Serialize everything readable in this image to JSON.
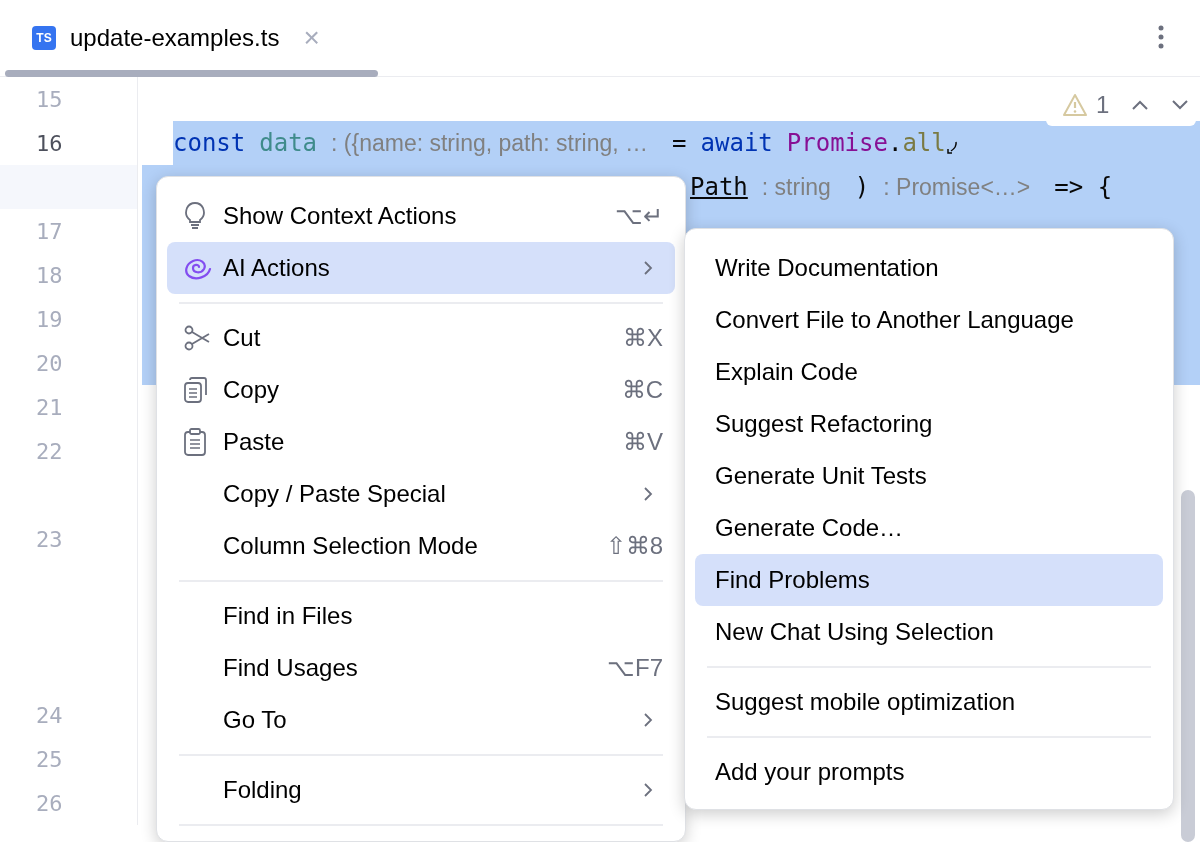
{
  "tab": {
    "badge": "TS",
    "label": "update-examples.ts",
    "selected": true,
    "close": "×"
  },
  "inspection": {
    "count": "1"
  },
  "editor": {
    "lines": [
      {
        "number": "15",
        "kind": "line",
        "selected": false
      },
      {
        "number": "16",
        "kind": "line",
        "selected": true,
        "tokens": [
          {
            "kind": "keyword",
            "text": "const"
          },
          {
            "kind": "variable",
            "text": "data"
          },
          {
            "kind": "hint",
            "text": ": ({name: string, path: string, …"
          },
          {
            "kind": "plain",
            "text": "="
          },
          {
            "kind": "keyword",
            "text": "await"
          },
          {
            "kind": "group",
            "parts": [
              {
                "kind": "class",
                "text": "Promise"
              },
              {
                "kind": "plain",
                "text": "."
              },
              {
                "kind": "method",
                "text": "all"
              }
            ]
          }
        ]
      },
      {
        "kind": "wrap",
        "selected": true,
        "tokens": [
          {
            "kind": "param",
            "text": "Path"
          },
          {
            "kind": "hint",
            "text": ": string"
          },
          {
            "kind": "plain",
            "text": ")"
          },
          {
            "kind": "hint",
            "text": ": Promise<…>"
          },
          {
            "kind": "plain",
            "text": "=> {"
          }
        ]
      },
      {
        "number": "17",
        "kind": "line",
        "selected": true
      },
      {
        "number": "18",
        "kind": "line",
        "selected": true
      },
      {
        "number": "19",
        "kind": "line",
        "selected": true
      },
      {
        "number": "20",
        "kind": "line",
        "selected": true
      },
      {
        "number": "21",
        "kind": "line",
        "selected": false
      },
      {
        "number": "22",
        "kind": "line",
        "selected": false
      },
      {
        "kind": "blank",
        "selected": false
      },
      {
        "number": "23",
        "kind": "line",
        "selected": false
      },
      {
        "kind": "blank",
        "selected": false
      },
      {
        "kind": "blank",
        "selected": false
      },
      {
        "kind": "blank",
        "selected": false
      },
      {
        "number": "24",
        "kind": "line",
        "selected": false
      },
      {
        "number": "25",
        "kind": "line",
        "selected": false
      },
      {
        "number": "26",
        "kind": "line",
        "selected": false
      }
    ]
  },
  "context_menu": {
    "items": [
      {
        "kind": "item",
        "label": "Show Context Actions",
        "shortcut": "⌥↵",
        "submenu": false,
        "selected": false
      },
      {
        "kind": "item",
        "label": "AI Actions",
        "submenu": true,
        "selected": true
      },
      {
        "kind": "separator"
      },
      {
        "kind": "item",
        "label": "Cut",
        "shortcut": "⌘X",
        "submenu": false,
        "selected": false
      },
      {
        "kind": "item",
        "label": "Copy",
        "shortcut": "⌘C",
        "submenu": false,
        "selected": false
      },
      {
        "kind": "item",
        "label": "Paste",
        "shortcut": "⌘V",
        "submenu": false,
        "selected": false
      },
      {
        "kind": "item",
        "label": "Copy / Paste Special",
        "submenu": true,
        "selected": false
      },
      {
        "kind": "item",
        "label": "Column Selection Mode",
        "shortcut": "⇧⌘8",
        "submenu": false,
        "selected": false
      },
      {
        "kind": "separator"
      },
      {
        "kind": "item",
        "label": "Find in Files",
        "submenu": false,
        "selected": false
      },
      {
        "kind": "item",
        "label": "Find Usages",
        "shortcut": "⌥F7",
        "submenu": false,
        "selected": false
      },
      {
        "kind": "item",
        "label": "Go To",
        "submenu": true,
        "selected": false
      },
      {
        "kind": "separator"
      },
      {
        "kind": "item",
        "label": "Folding",
        "submenu": true,
        "selected": false
      },
      {
        "kind": "separator"
      }
    ]
  },
  "ai_submenu": {
    "items": [
      {
        "kind": "item",
        "label": "Write Documentation",
        "selected": false
      },
      {
        "kind": "item",
        "label": "Convert File to Another Language",
        "selected": false
      },
      {
        "kind": "item",
        "label": "Explain Code",
        "selected": false
      },
      {
        "kind": "item",
        "label": "Suggest Refactoring",
        "selected": false
      },
      {
        "kind": "item",
        "label": "Generate Unit Tests",
        "selected": false
      },
      {
        "kind": "item",
        "label": "Generate Code…",
        "selected": false
      },
      {
        "kind": "item",
        "label": "Find Problems",
        "selected": true
      },
      {
        "kind": "item",
        "label": "New Chat Using Selection",
        "selected": false
      },
      {
        "kind": "separator"
      },
      {
        "kind": "item",
        "label": "Suggest mobile optimization",
        "selected": false
      },
      {
        "kind": "separator"
      },
      {
        "kind": "item",
        "label": "Add your prompts",
        "selected": false
      }
    ]
  }
}
